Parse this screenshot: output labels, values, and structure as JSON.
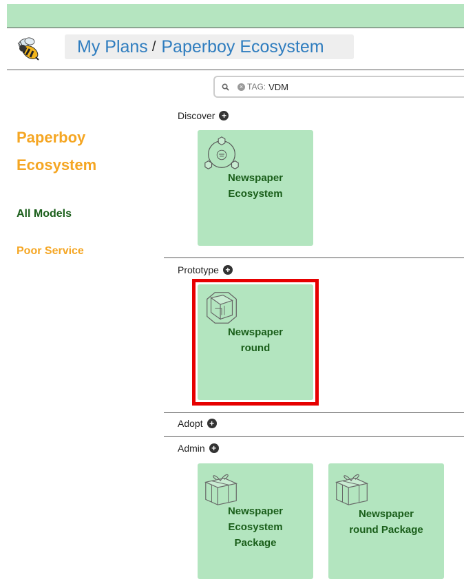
{
  "header": {
    "logo_icon": "bee-icon",
    "breadcrumb_root": "My Plans",
    "breadcrumb_sep": "/",
    "breadcrumb_current": "Paperboy Ecosystem",
    "colors": {
      "topbar": "#b5e5c0",
      "link": "#2f7dbf"
    }
  },
  "sidebar": {
    "title": "Paperboy Ecosystem",
    "items": [
      {
        "label": "All Models",
        "color": "#1a5e1a"
      },
      {
        "label": "Poor Service",
        "color": "#f5a623"
      }
    ]
  },
  "search": {
    "icon": "search-icon",
    "tag_prefix": "TAG:",
    "tag_value": "VDM"
  },
  "sections": [
    {
      "label": "Discover",
      "cards": [
        {
          "label": "Newspaper Ecosystem",
          "icon": "ecosystem-cycle-icon"
        }
      ]
    },
    {
      "label": "Prototype",
      "cards": [
        {
          "label": "Newspaper round",
          "icon": "cube-icon",
          "highlighted": true
        }
      ]
    },
    {
      "label": "Adopt",
      "cards": []
    },
    {
      "label": "Admin",
      "cards": [
        {
          "label": "Newspaper Ecosystem Package",
          "icon": "gift-package-icon"
        },
        {
          "label": "Newspaper round Package",
          "icon": "gift-package-icon"
        }
      ]
    }
  ],
  "colors": {
    "card_bg": "#b3e5bf",
    "card_text": "#1a5e1a",
    "highlight": "#e60000",
    "accent": "#f5a623"
  }
}
